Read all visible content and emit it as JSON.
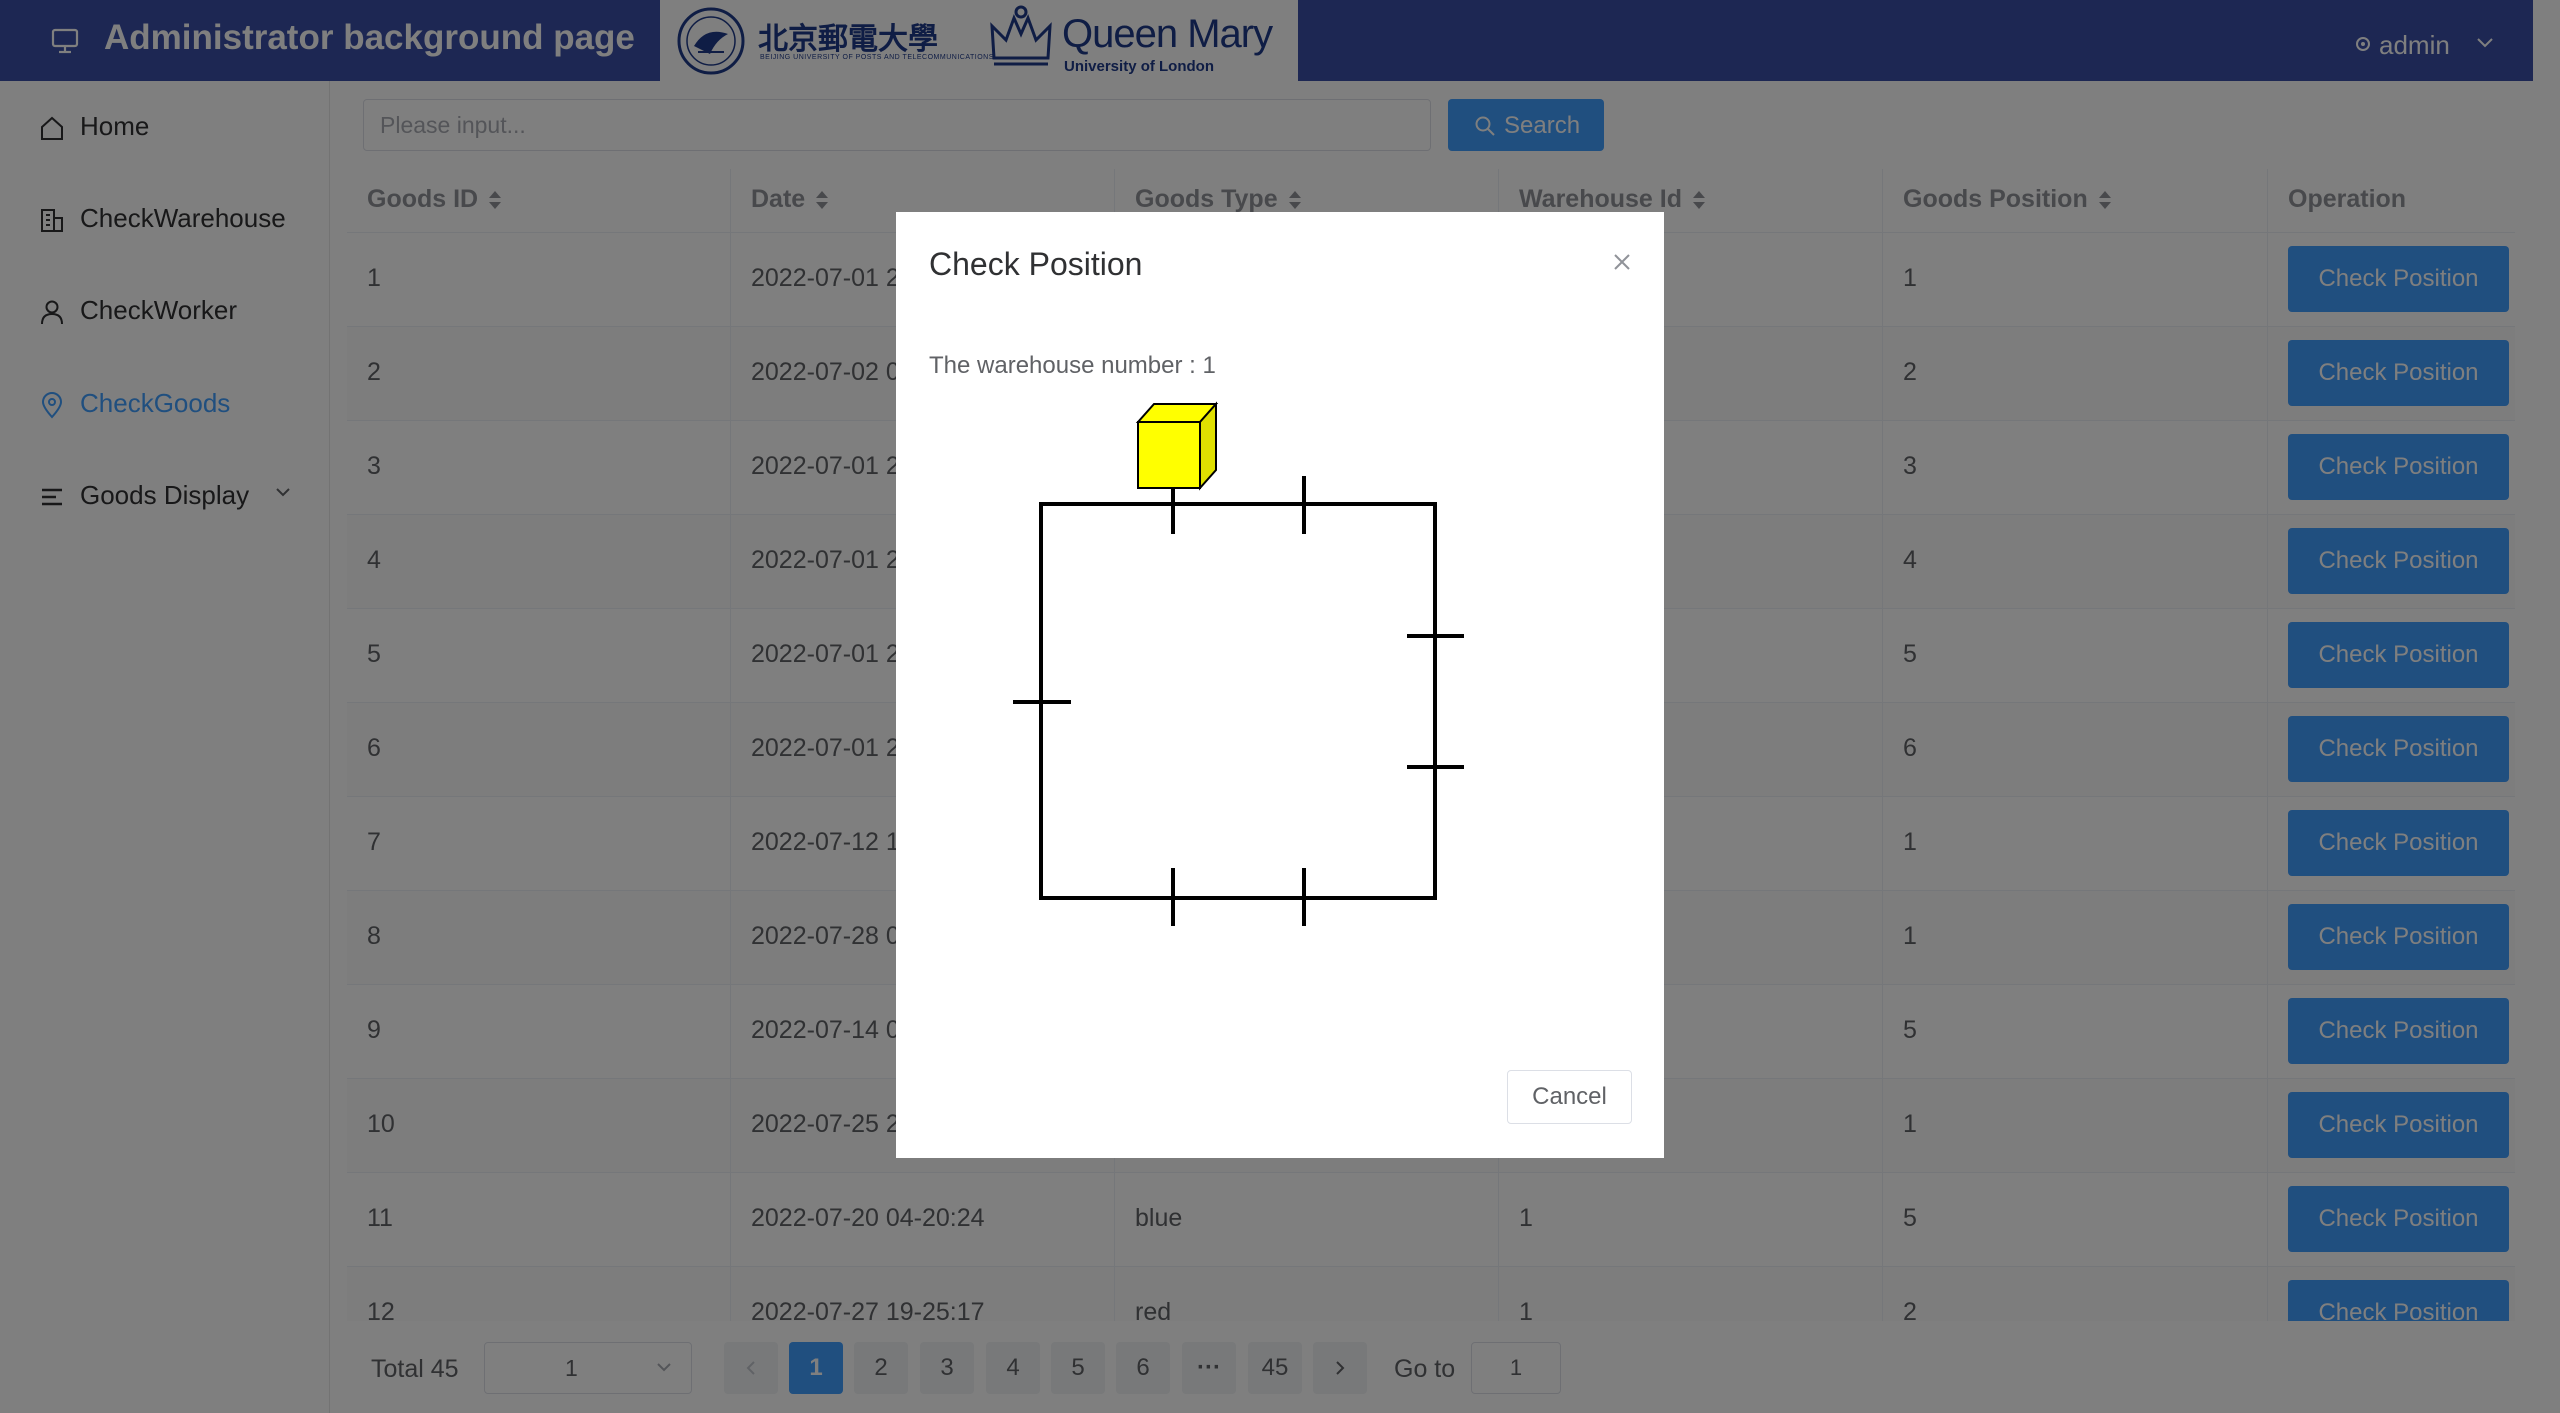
{
  "header": {
    "app_title": "Administrator background page",
    "bupt_name": "北京郵電大學",
    "bupt_subtitle": "BEIJING UNIVERSITY OF POSTS AND TELECOMMUNICATIONS",
    "qm_name": "Queen Mary",
    "qm_subtitle": "University of London",
    "user": "admin",
    "brand_color": "#3b4ea6"
  },
  "sidebar": {
    "items": [
      {
        "label": "Home",
        "icon": "home-icon"
      },
      {
        "label": "CheckWarehouse",
        "icon": "building-icon"
      },
      {
        "label": "CheckWorker",
        "icon": "user-icon"
      },
      {
        "label": "CheckGoods",
        "icon": "location-pin-icon",
        "active": true
      },
      {
        "label": "Goods Display",
        "icon": "menu-lines-icon",
        "expandable": true
      }
    ],
    "active_color": "#409eff"
  },
  "search": {
    "placeholder": "Please input...",
    "button_label": "Search"
  },
  "table": {
    "columns": [
      "Goods ID",
      "Date",
      "Goods Type",
      "Warehouse Id",
      "Goods Position",
      "Operation"
    ],
    "rows": [
      {
        "id": "1",
        "date": "2022-07-01 2",
        "type": "",
        "warehouse": "",
        "position": "1"
      },
      {
        "id": "2",
        "date": "2022-07-02 0",
        "type": "",
        "warehouse": "",
        "position": "2"
      },
      {
        "id": "3",
        "date": "2022-07-01 2",
        "type": "",
        "warehouse": "",
        "position": "3"
      },
      {
        "id": "4",
        "date": "2022-07-01 2",
        "type": "",
        "warehouse": "",
        "position": "4"
      },
      {
        "id": "5",
        "date": "2022-07-01 2",
        "type": "",
        "warehouse": "",
        "position": "5"
      },
      {
        "id": "6",
        "date": "2022-07-01 2",
        "type": "",
        "warehouse": "",
        "position": "6"
      },
      {
        "id": "7",
        "date": "2022-07-12 1",
        "type": "",
        "warehouse": "",
        "position": "1"
      },
      {
        "id": "8",
        "date": "2022-07-28 0",
        "type": "",
        "warehouse": "",
        "position": "1"
      },
      {
        "id": "9",
        "date": "2022-07-14 0",
        "type": "",
        "warehouse": "",
        "position": "5"
      },
      {
        "id": "10",
        "date": "2022-07-25 2",
        "type": "",
        "warehouse": "",
        "position": "1"
      },
      {
        "id": "11",
        "date": "2022-07-20 04-20:24",
        "type": "blue",
        "warehouse": "1",
        "position": "5"
      },
      {
        "id": "12",
        "date": "2022-07-27 19-25:17",
        "type": "red",
        "warehouse": "1",
        "position": "2"
      }
    ],
    "action_label": "Check Position"
  },
  "pagination": {
    "total_label": "Total 45",
    "page_size": "1",
    "pages": [
      "1",
      "2",
      "3",
      "4",
      "5",
      "6",
      "···",
      "45"
    ],
    "current": "1",
    "goto_label": "Go to",
    "goto_value": "1"
  },
  "modal": {
    "title": "Check Position",
    "warehouse_text": "The warehouse number : 1",
    "cancel_label": "Cancel",
    "box_color": "#ffff00"
  }
}
